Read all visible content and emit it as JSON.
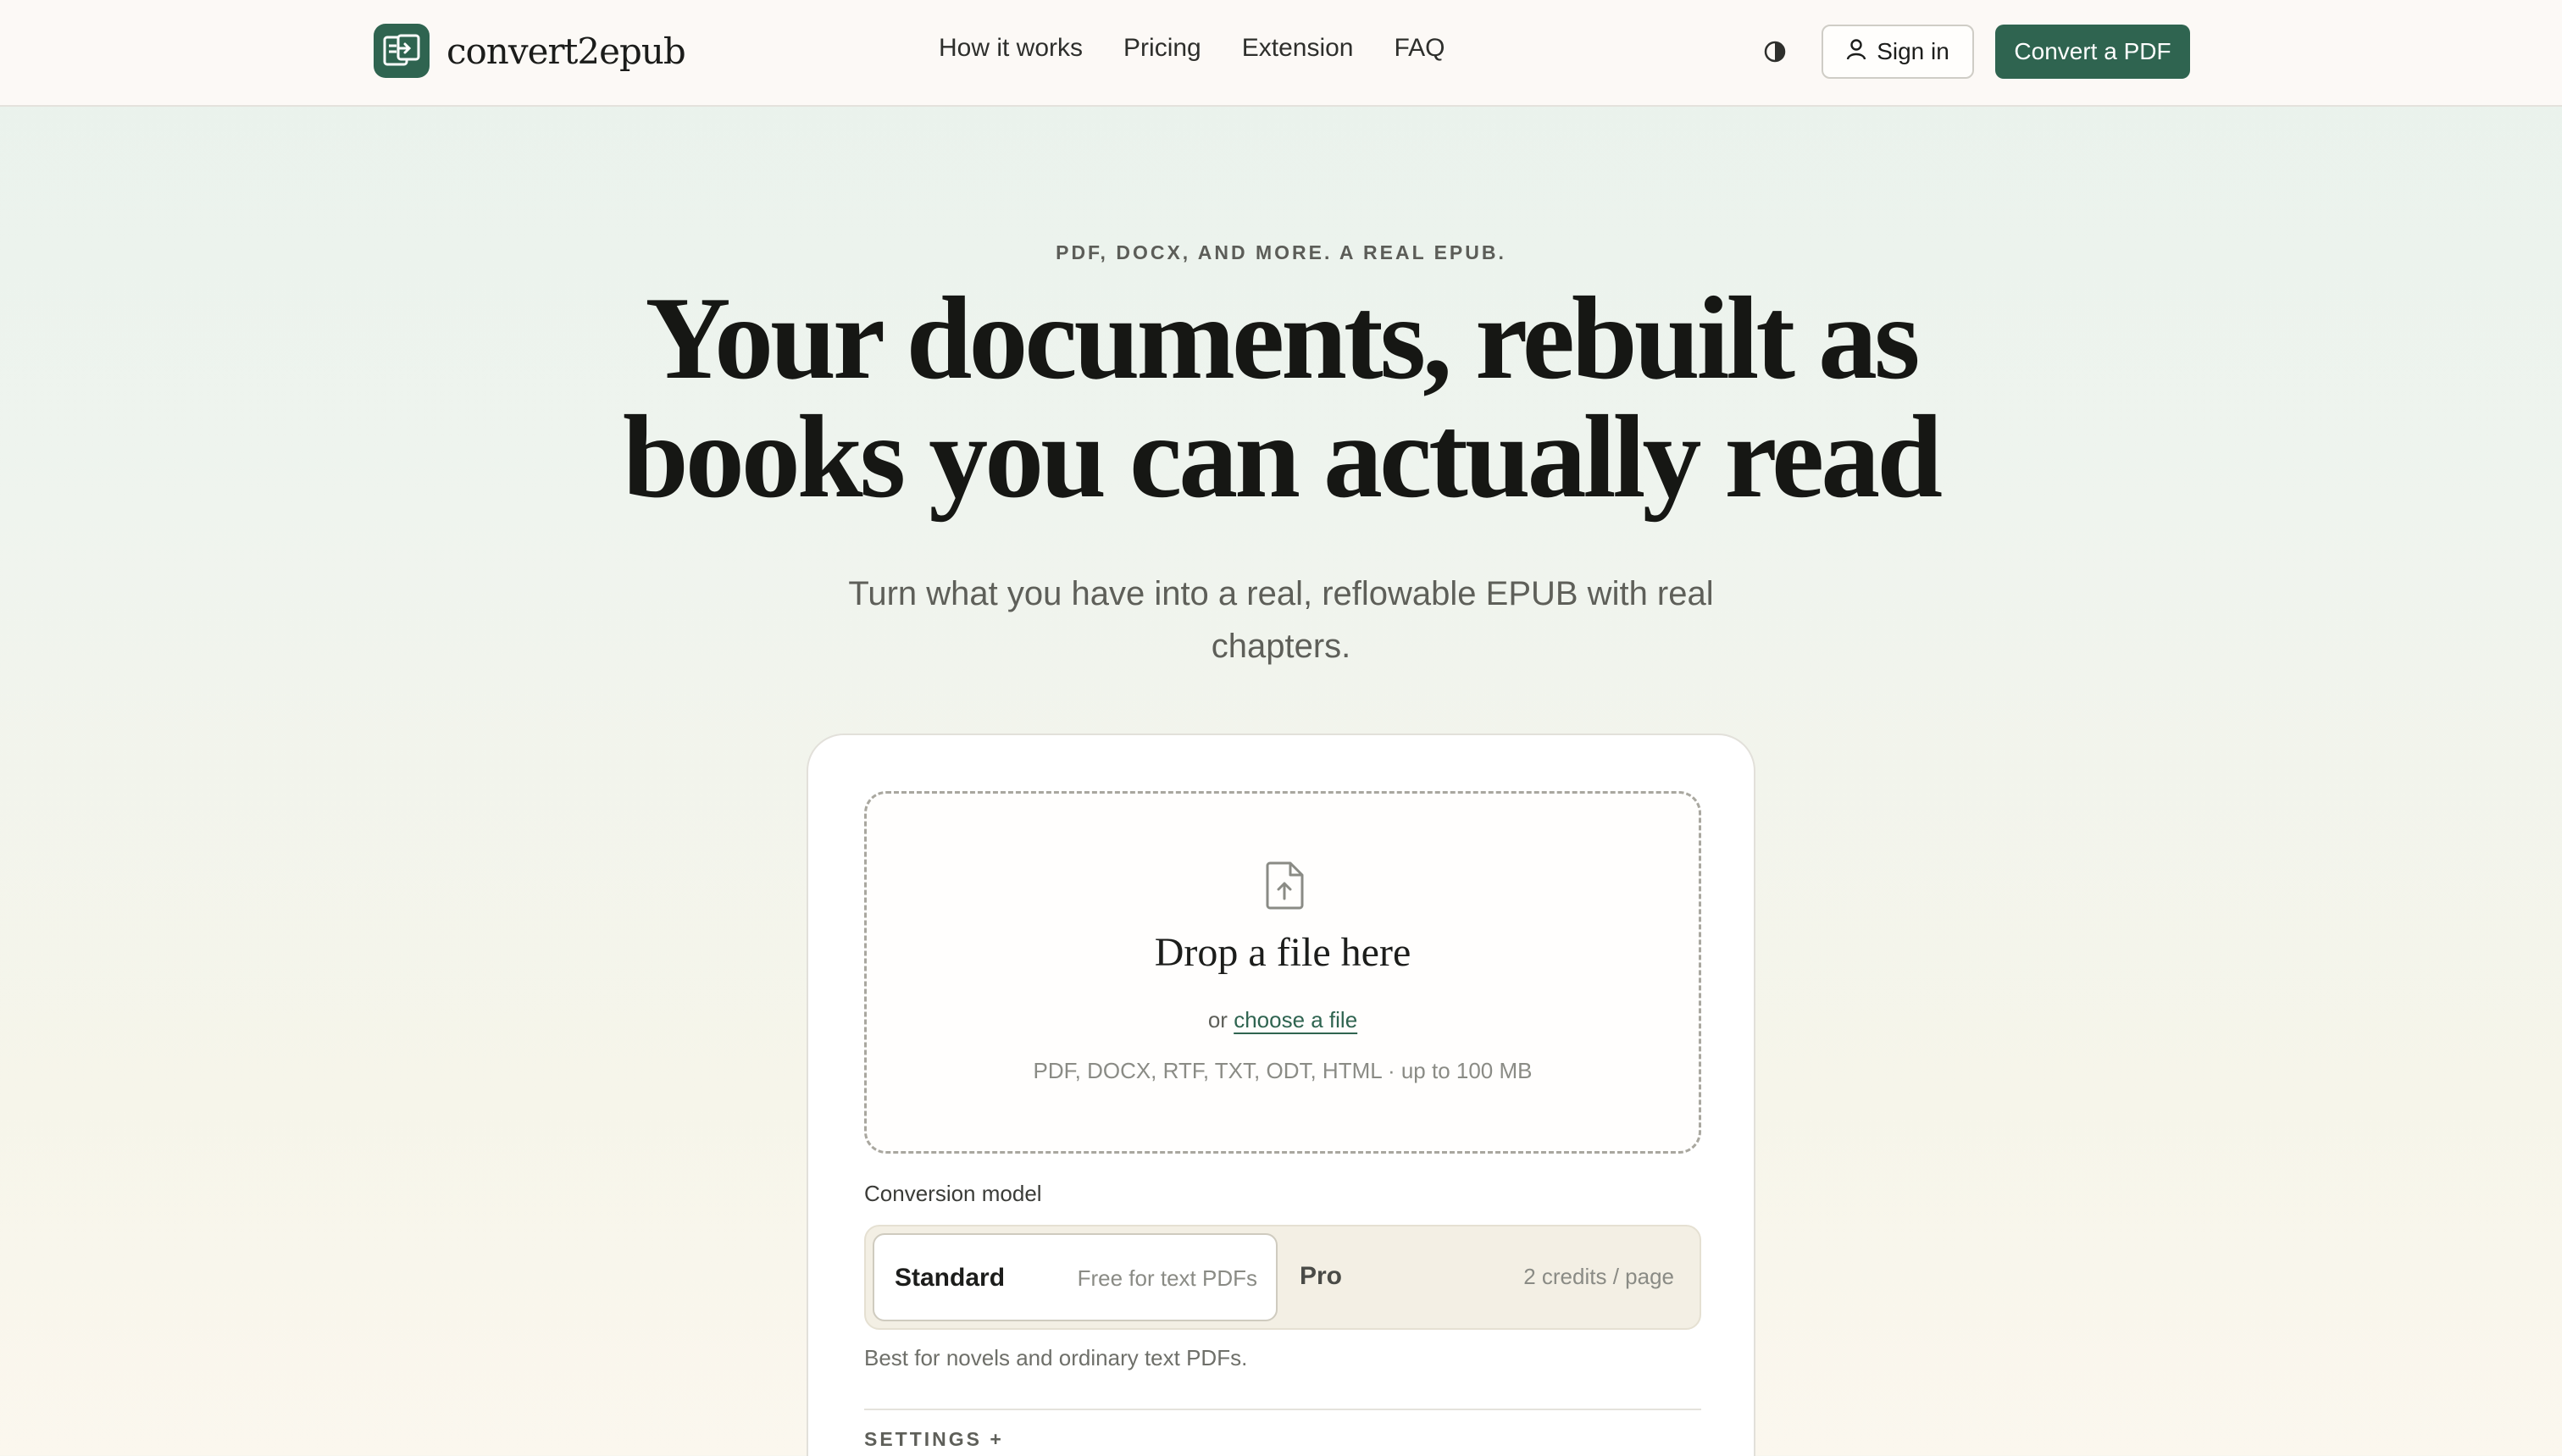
{
  "header": {
    "brand": "convert2epub",
    "nav": [
      "How it works",
      "Pricing",
      "Extension",
      "FAQ"
    ],
    "signin_label": "Sign in",
    "cta_label": "Convert a PDF",
    "icons": {
      "logo": "convert-logo-icon",
      "theme": "contrast-icon",
      "user": "user-icon"
    }
  },
  "hero": {
    "eyebrow": "PDF, DOCX, AND MORE. A REAL EPUB.",
    "headline_line1": "Your documents, rebuilt as",
    "headline_line2": "books you can actually read",
    "subhead": "Turn what you have into a real, reflowable EPUB with real chapters."
  },
  "upload": {
    "icon": "file-upload-icon",
    "title": "Drop a file here",
    "or_text": "or",
    "choose_link": "choose a file",
    "formats": "PDF, DOCX, RTF, TXT, ODT, HTML · up to 100 MB"
  },
  "model": {
    "label": "Conversion model",
    "options": [
      {
        "name": "Standard",
        "note": "Free for text PDFs",
        "selected": true
      },
      {
        "name": "Pro",
        "note": "2 credits / page",
        "selected": false
      }
    ],
    "description": "Best for novels and ordinary text PDFs."
  },
  "settings_label": "SETTINGS +",
  "colors": {
    "accent": "#2f6450",
    "background": "#eff4ee",
    "card": "#ffffff"
  }
}
